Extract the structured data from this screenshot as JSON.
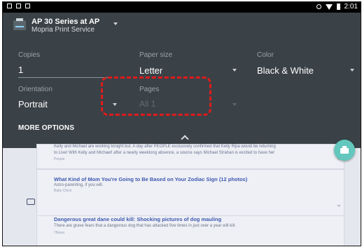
{
  "status_bar": {
    "time": "2:01",
    "left_icons": [
      "camera-icon",
      "message-icon",
      "document-icon"
    ],
    "right_icons": [
      "sync-icon",
      "wifi-icon",
      "battery-icon"
    ]
  },
  "printer": {
    "name": "AP 30 Series at AP",
    "service": "Mopria Print Service"
  },
  "options": {
    "copies_label": "Copies",
    "copies_value": "1",
    "paper_size_label": "Paper size",
    "paper_size_value": "Letter",
    "color_label": "Color",
    "color_value": "Black & White",
    "orientation_label": "Orientation",
    "orientation_value": "Portrait",
    "pages_label": "Pages",
    "pages_value": "All 1"
  },
  "more_options_label": "MORE OPTIONS",
  "fab_icon": "print-icon",
  "feed": {
    "snippet_line1": "Kelly and Michael are working tonight but. A day after PEOPLE exclusively confirmed that Kelly Ripa would be returning",
    "snippet_line2": "to Live! With Kelly and Michael! after a nearly weeklong absence, a source says Michael Strahan is excited to have her",
    "snippet_source": "People",
    "article1_title": "What Kind of Mom You're Going to Be Based on Your Zodiac Sign (12 photos)",
    "article1_sub": "Astro-parenting, if you will.",
    "article1_source": "Baby Chick",
    "article2_title": "Dangerous great dane could kill: Shocking pictures of dog mauling",
    "article2_sub": "There are grave fears that a dangerous dog that has attacked five times in just over a year will kill.",
    "article2_source": "7News"
  },
  "colors": {
    "panel_bg": "#3a4147",
    "accent_fab": "#63c7bd",
    "highlight": "#e01b1b",
    "link_blue": "#3f58b0"
  }
}
